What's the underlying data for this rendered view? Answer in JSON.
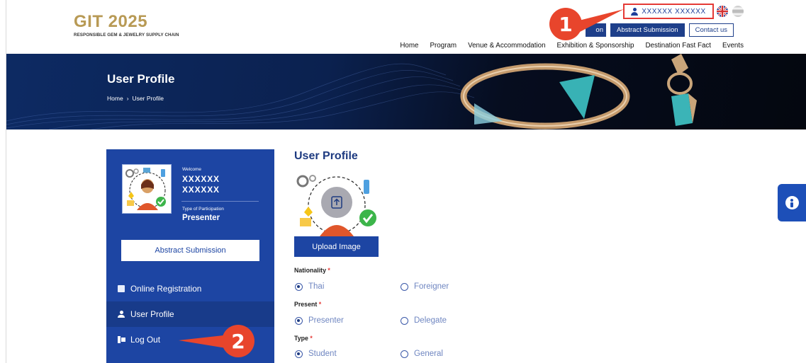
{
  "header": {
    "logo_title": "GIT 2025",
    "logo_subtitle": "RESPONSIBLE GEM & JEWELRY SUPPLY CHAIN",
    "user_name": "XXXXXX XXXXXX",
    "top_buttons": {
      "partial_label": "on",
      "abstract_submission": "Abstract Submission",
      "contact_us": "Contact us"
    },
    "nav": [
      "Home",
      "Program",
      "Venue & Accommodation",
      "Exhibition & Sponsorship",
      "Destination Fast Fact",
      "Events"
    ]
  },
  "annotations": {
    "step1": "1",
    "step2": "2",
    "color": "#e8452c"
  },
  "banner": {
    "title": "User Profile",
    "breadcrumb": {
      "home": "Home",
      "separator": "›",
      "current": "User Profile"
    }
  },
  "sidebar": {
    "welcome_label": "Welcome",
    "first_name": "XXXXXX",
    "last_name": "XXXXXX",
    "participation_label": "Type of Participation",
    "participation_value": "Presenter",
    "abstract_button": "Abstract Submission",
    "menu": {
      "online_registration": "Online Registration",
      "user_profile": "User Profile",
      "log_out": "Log Out"
    },
    "colors": {
      "panel": "#1d45a3",
      "active": "#183b8a"
    }
  },
  "profile": {
    "title": "User Profile",
    "upload_button": "Upload Image",
    "nationality": {
      "label": "Nationality",
      "required": "*",
      "options": [
        "Thai",
        "Foreigner"
      ],
      "selected": "Thai"
    },
    "present": {
      "label": "Present",
      "required": "*",
      "options": [
        "Presenter",
        "Delegate"
      ],
      "selected": "Presenter"
    },
    "type": {
      "label": "Type",
      "required": "*",
      "options": [
        "Student",
        "General"
      ],
      "selected": "Student"
    }
  }
}
